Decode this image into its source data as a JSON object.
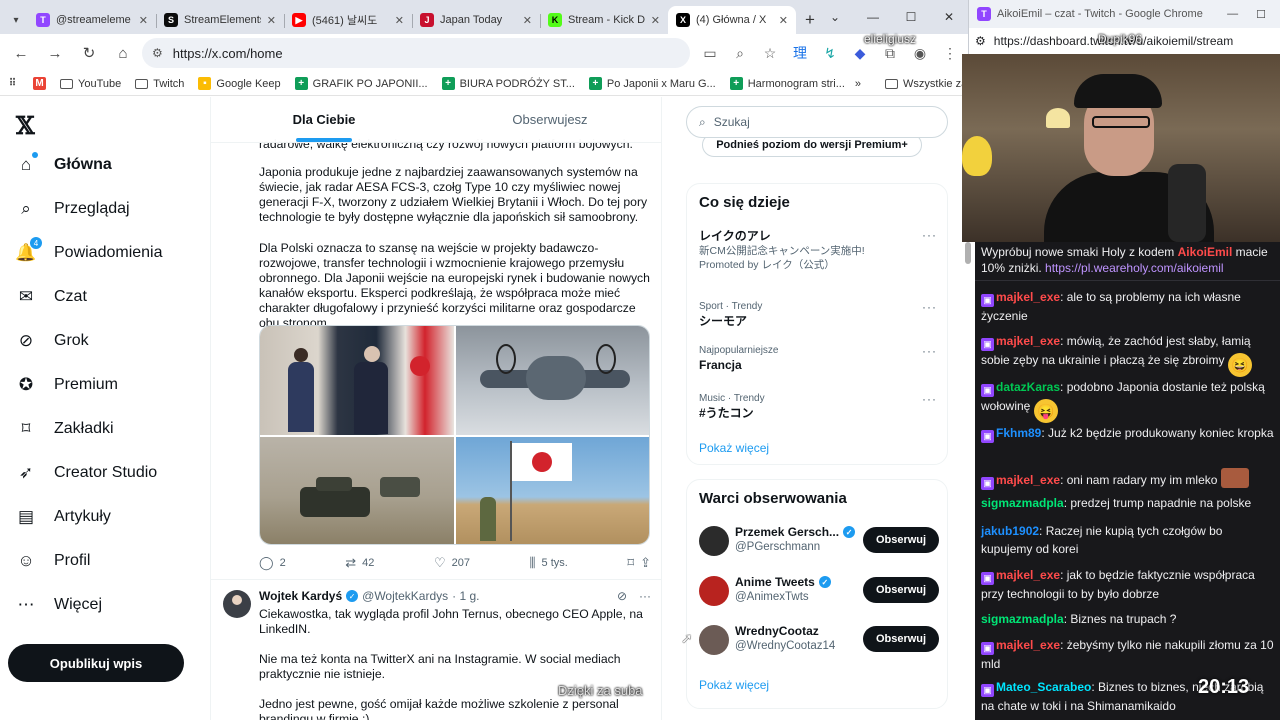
{
  "browser": {
    "tabs": [
      {
        "title": "@streameleme",
        "icon": "twitch-icon",
        "color": "#9146ff",
        "glyph": "T"
      },
      {
        "title": "StreamElements",
        "icon": "streamelements-icon",
        "color": "#0c0c0c",
        "glyph": "S"
      },
      {
        "title": "(5461) 날씨도",
        "icon": "youtube-icon",
        "color": "#ff0000",
        "glyph": "▶"
      },
      {
        "title": "Japan Today",
        "icon": "japantoday-icon",
        "color": "#c8102e",
        "glyph": "J"
      },
      {
        "title": "Stream - Kick D",
        "icon": "kick-icon",
        "color": "#53fc18",
        "glyph": "K"
      },
      {
        "title": "(4) Główna / X",
        "icon": "x-icon",
        "color": "#000000",
        "glyph": "X",
        "active": true
      }
    ],
    "url": "https://x.com/home",
    "bookmarks": [
      {
        "label": "",
        "icon": "apps-grid-icon"
      },
      {
        "label": "",
        "icon": "gmail-icon"
      },
      {
        "label": "YouTube",
        "icon": "folder-icon"
      },
      {
        "label": "Twitch",
        "icon": "folder-icon"
      },
      {
        "label": "Google Keep",
        "icon": "keep-icon"
      },
      {
        "label": "GRAFIK PO JAPONII...",
        "icon": "sheets-icon"
      },
      {
        "label": "BIURA PODRÓŻY ST...",
        "icon": "sheets-icon"
      },
      {
        "label": "Po Japonii x Maru G...",
        "icon": "sheets-icon"
      },
      {
        "label": "Harmonogram stri...",
        "icon": "sheets-icon"
      }
    ],
    "bookmarks_all": "Wszystkie zakładki"
  },
  "nav": {
    "items": [
      {
        "label": "Główna",
        "icon": "home-icon",
        "bold": true
      },
      {
        "label": "Przeglądaj",
        "icon": "search-icon"
      },
      {
        "label": "Powiadomienia",
        "icon": "bell-icon",
        "badge": "4"
      },
      {
        "label": "Czat",
        "icon": "chat-icon"
      },
      {
        "label": "Grok",
        "icon": "grok-icon"
      },
      {
        "label": "Premium",
        "icon": "premium-icon"
      },
      {
        "label": "Zakładki",
        "icon": "bookmark-icon"
      },
      {
        "label": "Creator Studio",
        "icon": "rocket-icon"
      },
      {
        "label": "Artykuły",
        "icon": "article-icon"
      },
      {
        "label": "Profil",
        "icon": "profile-icon"
      },
      {
        "label": "Więcej",
        "icon": "more-icon"
      }
    ],
    "post_button": "Opublikuj wpis"
  },
  "feed": {
    "tabs": [
      "Dla Ciebie",
      "Obserwujesz"
    ],
    "post1": {
      "line0": "radarowe, walkę elektroniczną czy rozwój nowych platform bojowych.",
      "para1": "Japonia produkuje jedne z najbardziej zaawansowanych systemów na świecie, jak radar AESA FCS-3, czołg Type 10 czy myśliwiec nowej generacji F-X, tworzony z udziałem Wielkiej Brytanii i Włoch. Do tej pory technologie te były dostępne wyłącznie dla japońskich sił samoobrony.",
      "para2": "Dla Polski oznacza to szansę na wejście w projekty badawczo-rozwojowe, transfer technologii i wzmocnienie krajowego przemysłu obronnego. Dla Japonii wejście na europejski rynek i budowanie nowych kanałów eksportu. Eksperci podkreślają, że współpraca może mieć charakter długofalowy i przynieść korzyści militarne oraz gospodarcze obu stronom.",
      "replies": "2",
      "reposts": "42",
      "likes": "207",
      "views": "5 tys."
    },
    "post2": {
      "name": "Wojtek Kardyś",
      "handle": "@WojtekKardys",
      "time": "· 1 g.",
      "para1": "Ciekawostka, tak wygląda profil John Ternus, obecnego CEO Apple, na LinkedIN.",
      "para2": "Nie ma też konta na TwitterX ani na Instagramie. W social mediach praktycznie nie istnieje.",
      "para3": "Jedno jest pewne, gość omijał każde możliwe szkolenie z personal brandingu w firmie :)"
    }
  },
  "sidebar": {
    "search_placeholder": "Szukaj",
    "premium_pill": "Podnieś poziom do wersji Premium+",
    "trends_title": "Co się dzieje",
    "trends": [
      {
        "meta": "",
        "title": "レイクのアレ",
        "sub": "新CM公開記念キャンペーン実施中!",
        "promo": "Promoted by レイク（公式）"
      },
      {
        "meta": "Sport · Trendy",
        "title": "シーモア",
        "sub": "",
        "promo": ""
      },
      {
        "meta": "Najpopularniejsze",
        "title": "Francja",
        "sub": "",
        "promo": ""
      },
      {
        "meta": "Music · Trendy",
        "title": "#うたコン",
        "sub": "",
        "promo": ""
      }
    ],
    "show_more": "Pokaż więcej",
    "follow_title": "Warci obserwowania",
    "follow": [
      {
        "name": "Przemek Gersch...",
        "handle": "@PGerschmann",
        "button": "Obserwuj",
        "color": "#2b2b2b"
      },
      {
        "name": "Anime Tweets",
        "handle": "@AnimexTwts",
        "button": "Obserwuj",
        "color": "#b8231f"
      },
      {
        "name": "WrednyCootaz",
        "handle": "@WrednyCootaz14",
        "button": "Obserwuj",
        "color": "#6b5b55"
      }
    ],
    "show_more2": "Pokaż więcej"
  },
  "overlay": {
    "streamer_name": "elieligiusz",
    "subtitle": "Dzięki za suba",
    "clock": "20:13",
    "dup_label": "Dupik96"
  },
  "win2": {
    "title": "AikoiEmil – czat - Twitch - Google Chrome",
    "url": "https://dashboard.twitch.tv/u/aikoiemil/stream"
  },
  "chat": {
    "promo_pre": "Wypróbuj nowe smaki Holy z kodem ",
    "promo_code": "AikoiEmil",
    "promo_mid": " macie 10% zniżki. ",
    "promo_link": "https://pl.weareholy.com/aikoiemil",
    "messages": [
      {
        "user": "majkel_exe",
        "color": "#ff4b4b",
        "text": ": ale to są problemy na ich własne życzenie"
      },
      {
        "user": "majkel_exe",
        "color": "#ff4b4b",
        "text": ": mówią, że zachód jest słaby, łamią sobie zęby na ukrainie i płaczą że się zbroimy"
      },
      {
        "user": "datazKaras",
        "color": "#00c853",
        "text": ": podobno Japonia dostanie też polską wołowinę"
      },
      {
        "user": "Fkhm89",
        "color": "#1e90ff",
        "text": ": Już k2 będzie produkowany koniec kropka"
      },
      {
        "user": "majkel_exe",
        "color": "#ff4b4b",
        "text": ": oni nam radary my im mleko"
      },
      {
        "user": "sigmazmadpla",
        "color": "#00e676",
        "text": ": predzej trump napadnie na polske"
      },
      {
        "user": "jakub1902",
        "color": "#1e90ff",
        "text": ": Raczej nie kupią tych czołgów bo kupujemy od korei"
      },
      {
        "user": "majkel_exe",
        "color": "#ff4b4b",
        "text": ": jak to będzie faktycznie współpraca przy technologii to by było dobrze"
      },
      {
        "user": "sigmazmadpla",
        "color": "#00e676",
        "text": ": Biznes na trupach ?"
      },
      {
        "user": "majkel_exe",
        "color": "#ff4b4b",
        "text": ": żebyśmy tylko nie nakupili złomu za 10 mld"
      },
      {
        "user": "Mateo_Scarabeo",
        "color": "#00e5ff",
        "text": ": Biznes to biznes, niech zarobią na chate w toki i na Shimanamikaido"
      }
    ]
  }
}
